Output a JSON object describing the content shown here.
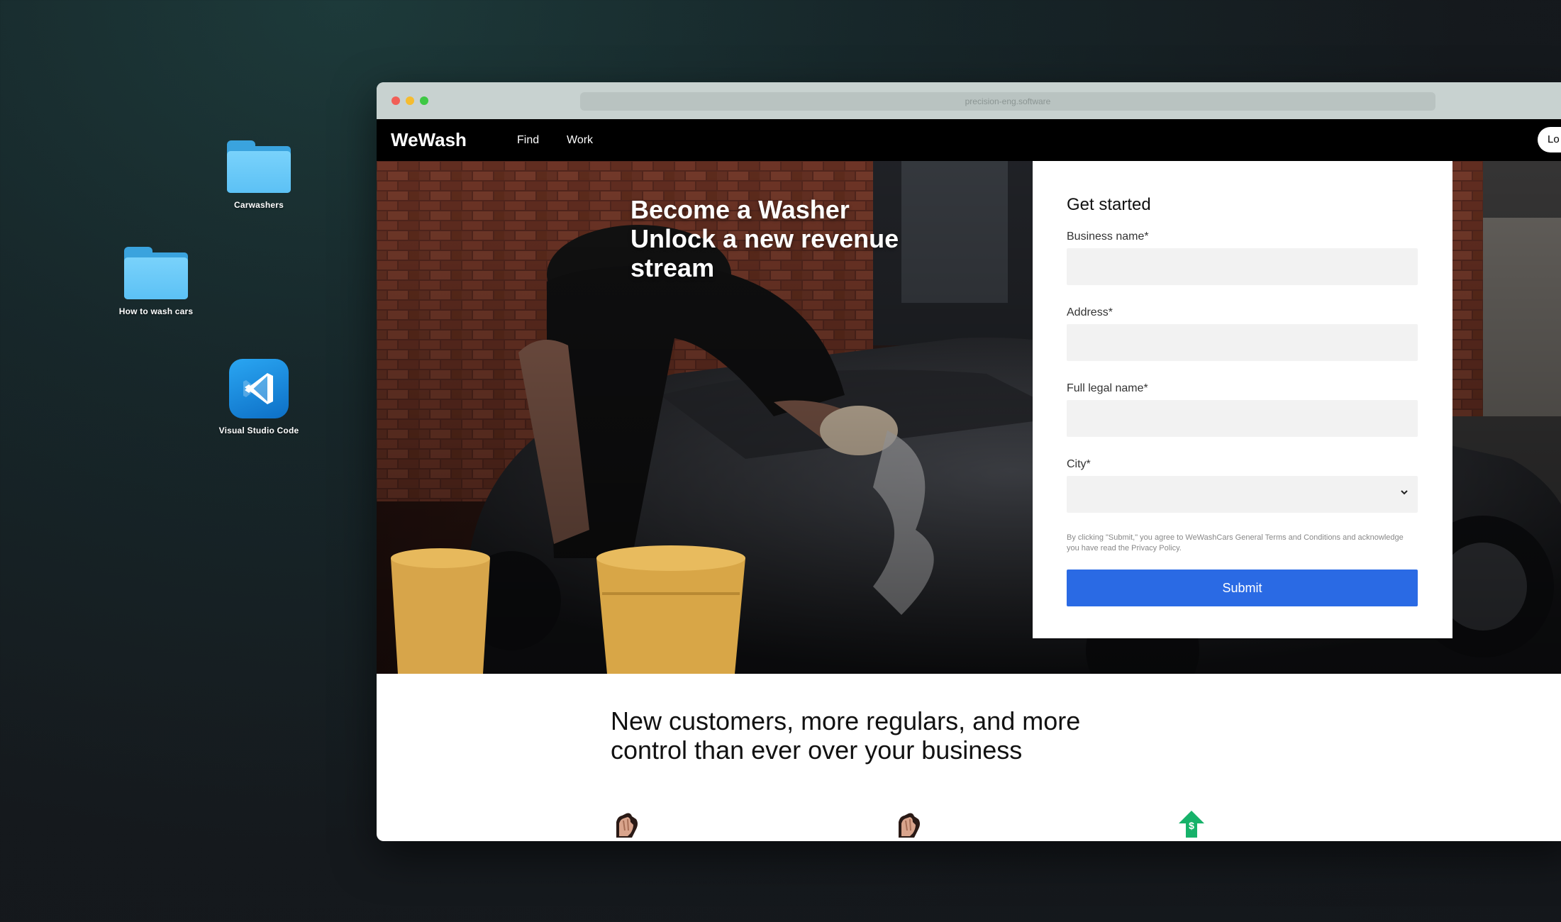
{
  "desktop": {
    "icons": [
      {
        "label": "Carwashers"
      },
      {
        "label": "How to wash cars"
      },
      {
        "label": "Visual Studio Code"
      }
    ]
  },
  "browser": {
    "url": "precision-eng.software"
  },
  "navbar": {
    "logo": "WeWash",
    "links": [
      "Find",
      "Work"
    ],
    "login_label": "Lo"
  },
  "hero": {
    "title_lines": [
      "Become a Washer",
      "Unlock a new revenue",
      "stream"
    ]
  },
  "form": {
    "title": "Get started",
    "fields": [
      {
        "label": "Business name*",
        "value": ""
      },
      {
        "label": "Address*",
        "value": ""
      },
      {
        "label": "Full legal name*",
        "value": ""
      },
      {
        "label": "City*",
        "value": ""
      }
    ],
    "terms": "By clicking \"Submit,\" you agree to WeWashCars General Terms and Conditions and acknowledge you have read the Privacy Policy.",
    "submit_label": "Submit",
    "accent_color": "#2a6ae4"
  },
  "section": {
    "heading_lines": [
      "New customers, more regulars, and more",
      "control than ever over your business"
    ],
    "feature_icons": [
      "hand-icon",
      "hand-icon",
      "money-up-arrow-icon"
    ]
  }
}
